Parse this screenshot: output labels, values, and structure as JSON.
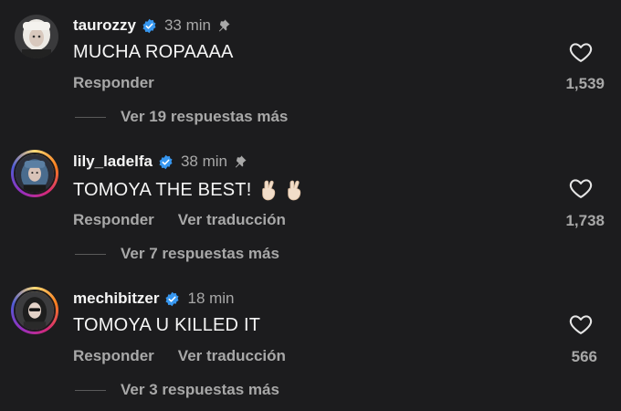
{
  "comments": [
    {
      "username": "taurozzy",
      "time": "33 min",
      "pinned": true,
      "text": "MUCHA ROPAAAA",
      "actions": [
        "Responder"
      ],
      "likes": "1,539",
      "replies": "Ver 19 respuestas más"
    },
    {
      "username": "lily_ladelfa",
      "time": "38 min",
      "pinned": true,
      "text": "TOMOYA THE BEST!",
      "emoji": "crossed-fingers-icon x2",
      "actions": [
        "Responder",
        "Ver traducción"
      ],
      "likes": "1,738",
      "replies": "Ver 7 respuestas más"
    },
    {
      "username": "mechibitzer",
      "time": "18 min",
      "pinned": false,
      "text": "TOMOYA U KILLED IT",
      "actions": [
        "Responder",
        "Ver traducción"
      ],
      "likes": "566",
      "replies": "Ver 3 respuestas más"
    }
  ],
  "colors": {
    "background": "#1c1c1e",
    "primary_text": "#f5f5f5",
    "secondary_text": "#a8a8a8",
    "verified_badge": "#3797f0"
  }
}
